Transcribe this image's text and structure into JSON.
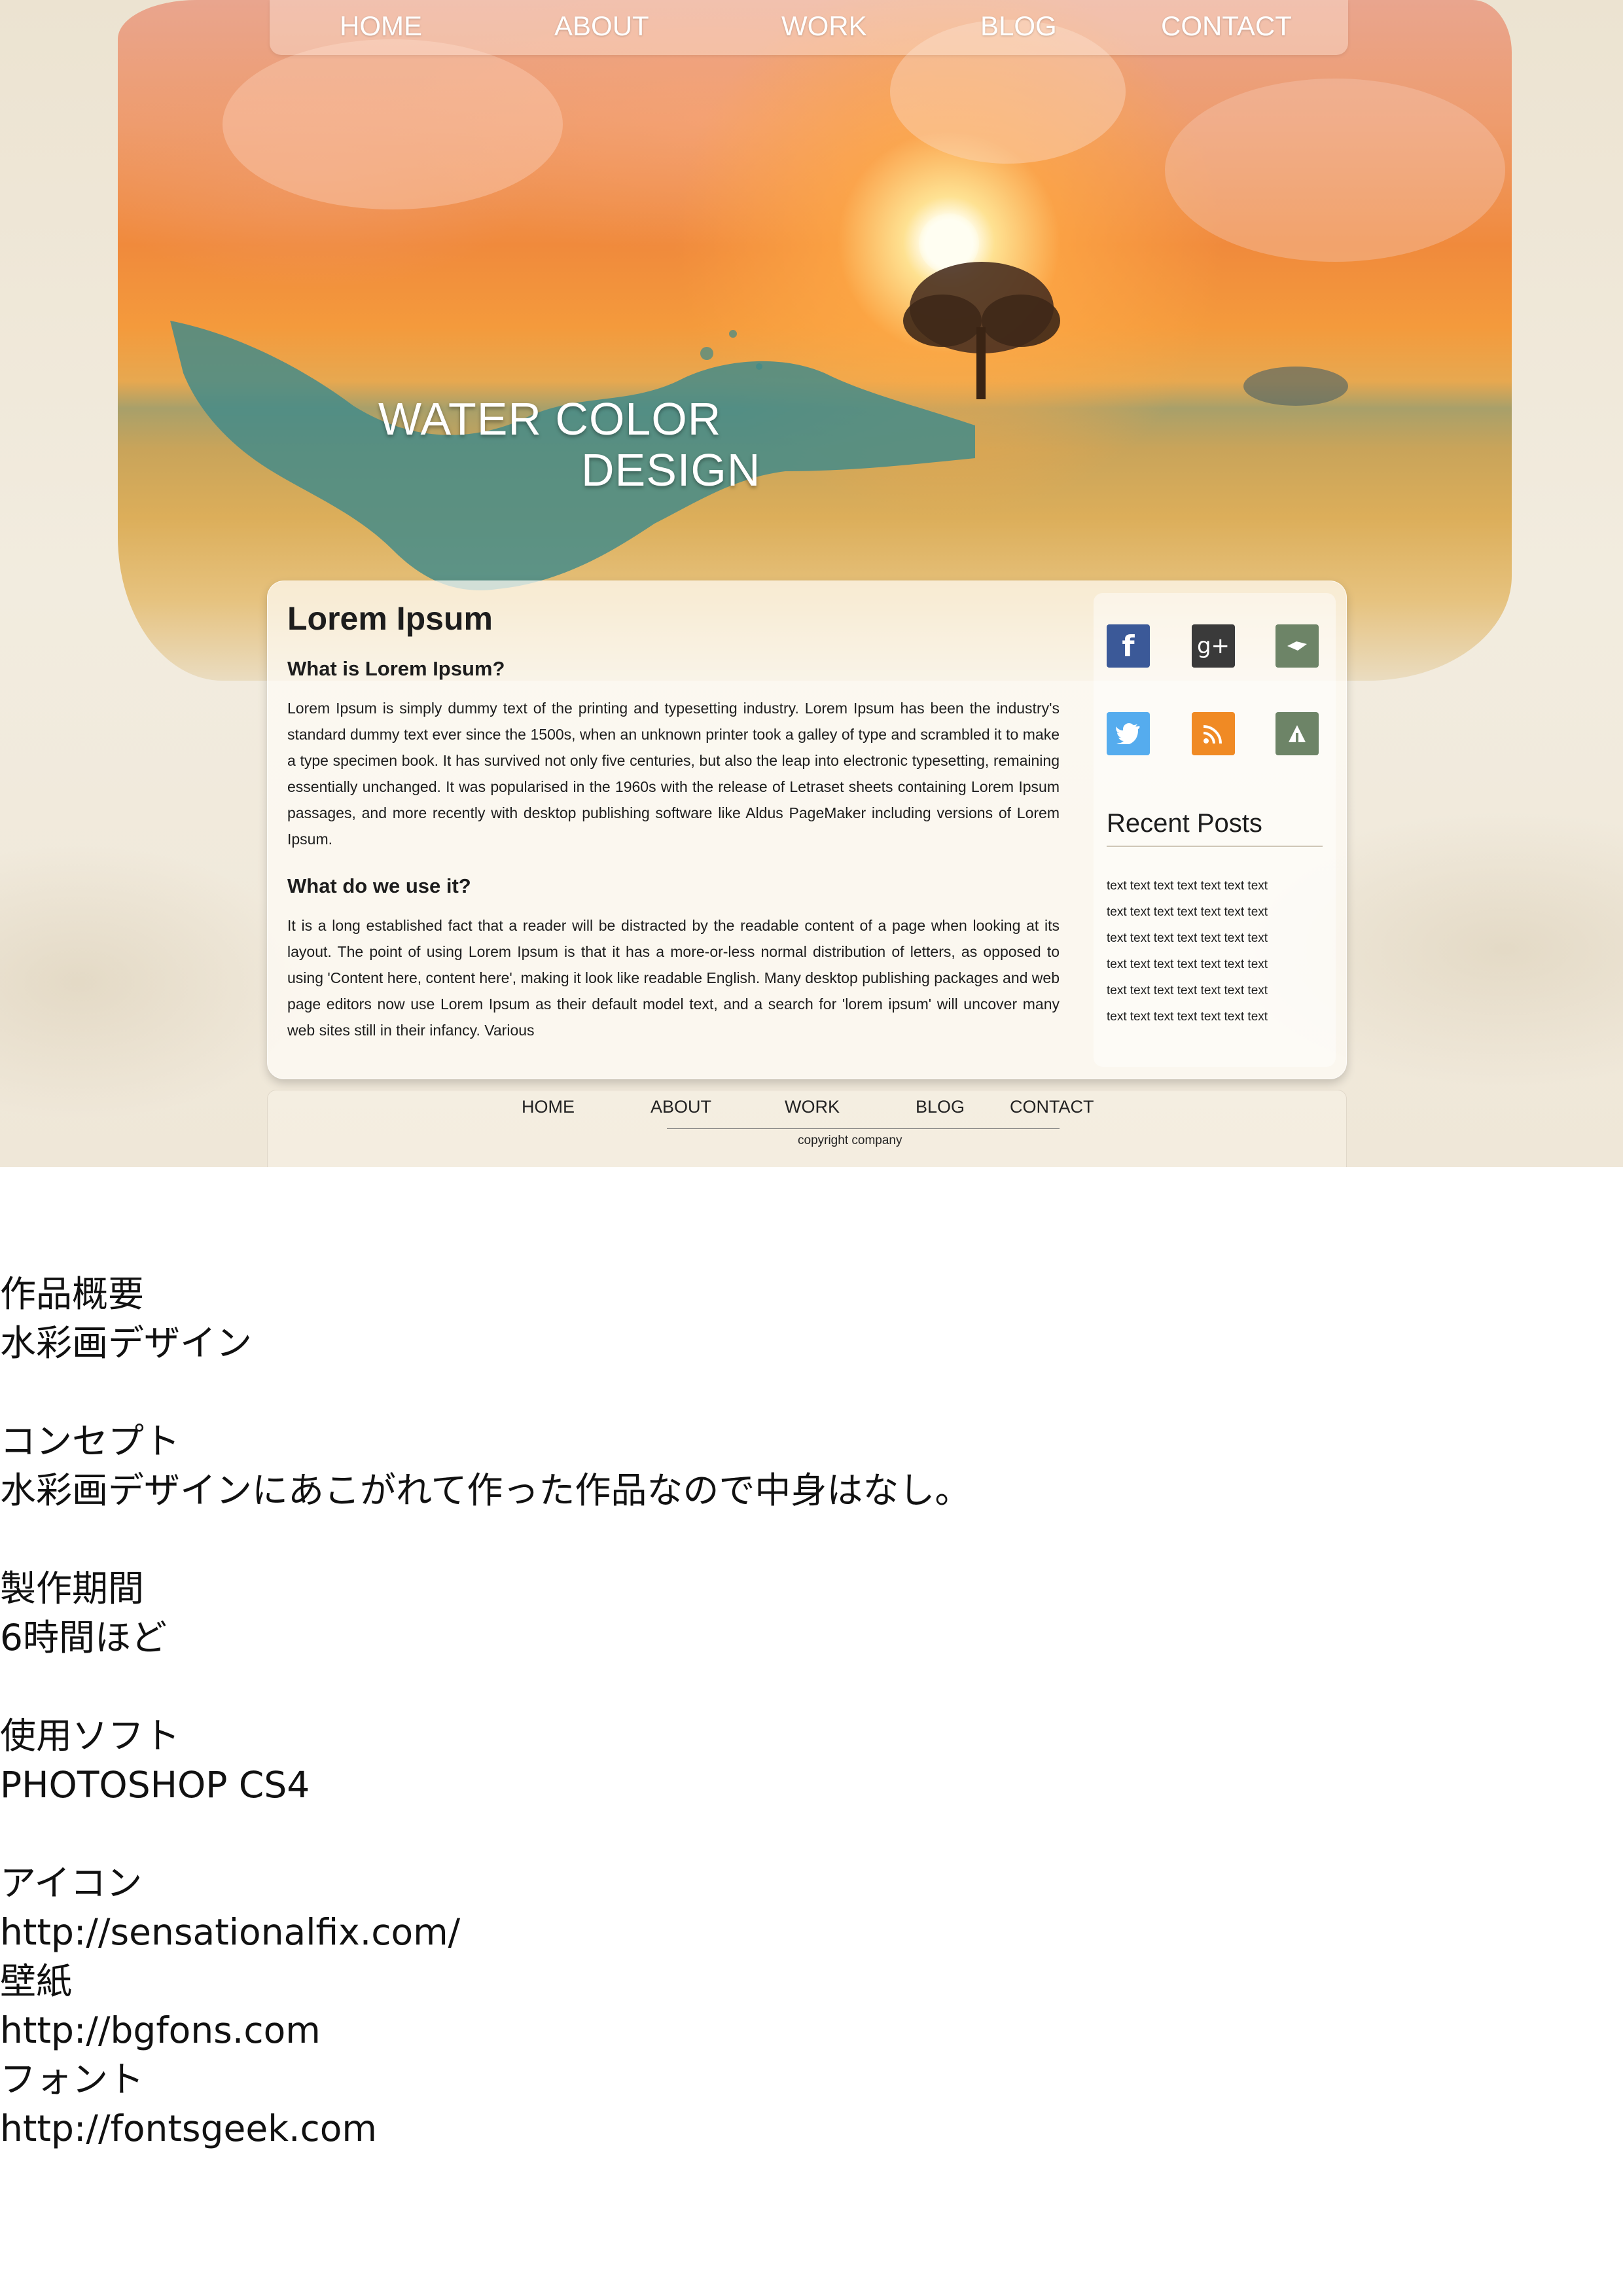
{
  "top_nav": [
    "HOME",
    "ABOUT",
    "WORK",
    "BLOG",
    "CONTACT"
  ],
  "hero": {
    "title_line1": "WATER COLOR",
    "title_line2": "DESIGN"
  },
  "content": {
    "title": "Lorem Ipsum",
    "section1": {
      "heading": "What is Lorem Ipsum?",
      "body": "Lorem Ipsum is simply dummy text of the printing and typesetting industry. Lorem Ipsum has been the industry's standard dummy text ever since the 1500s, when an unknown printer took a galley of type and scrambled it to make a type specimen book. It has survived not only five centuries, but also the leap into electronic typesetting, remaining essentially unchanged. It was popularised in the 1960s with the release of Letraset sheets containing Lorem Ipsum passages, and more recently with desktop publishing software like Aldus PageMaker including versions of Lorem Ipsum."
    },
    "section2": {
      "heading": "What do we use it?",
      "body": "It is a long established fact that a reader will be distracted by the readable content of a page when looking at its layout. The point of using Lorem Ipsum is that it has a more-or-less normal distribution of letters, as opposed to using 'Content here, content here', making it look like readable English. Many desktop publishing packages and web page editors now use Lorem Ipsum as their default model text, and a search for 'lorem ipsum' will uncover many web sites still in their infancy. Various"
    }
  },
  "sidebar": {
    "social_icons": [
      {
        "name": "facebook-icon",
        "glyph": "f",
        "color": "#3b5998"
      },
      {
        "name": "google-plus-icon",
        "glyph": "g+",
        "color": "#3a3a3a"
      },
      {
        "name": "bookmark-icon",
        "glyph": "",
        "color": "#6d8467"
      },
      {
        "name": "twitter-icon",
        "glyph": "",
        "color": "#55acee"
      },
      {
        "name": "rss-icon",
        "glyph": "",
        "color": "#f08a24"
      },
      {
        "name": "delicious-icon",
        "glyph": "",
        "color": "#6d8467"
      }
    ],
    "recent_posts_title": "Recent Posts",
    "recent_posts": [
      "text text text text text text text",
      "text text text text text text text",
      "text text text text text text text",
      "text text text text text text text",
      "text text text text text text text",
      "text text text text text text text"
    ]
  },
  "footer": {
    "nav": [
      "HOME",
      "ABOUT",
      "WORK",
      "BLOG",
      "CONTACT"
    ],
    "copyright": "copyright company"
  },
  "description": [
    {
      "heading": "作品概要",
      "lines": [
        "水彩画デザイン"
      ]
    },
    {
      "heading": "コンセプト",
      "lines": [
        "水彩画デザインにあこがれて作った作品なので中身はなし。"
      ]
    },
    {
      "heading": "製作期間",
      "lines": [
        "6時間ほど"
      ]
    },
    {
      "heading": "使用ソフト",
      "lines": [
        "PHOTOSHOP CS4"
      ]
    },
    {
      "heading": "アイコン",
      "lines": [
        "http://sensationalfix.com/"
      ]
    },
    {
      "heading": "壁紙",
      "lines": [
        "http://bgfons.com"
      ]
    },
    {
      "heading": "フォント",
      "lines": [
        "http://fontsgeek.com"
      ]
    }
  ],
  "colors": {
    "sky_top": "#e9a58e",
    "sky_mid": "#f08a3c",
    "field": "#dcae5a",
    "teal_splash": "#3f8a8a",
    "paper": "#efe7d8"
  }
}
